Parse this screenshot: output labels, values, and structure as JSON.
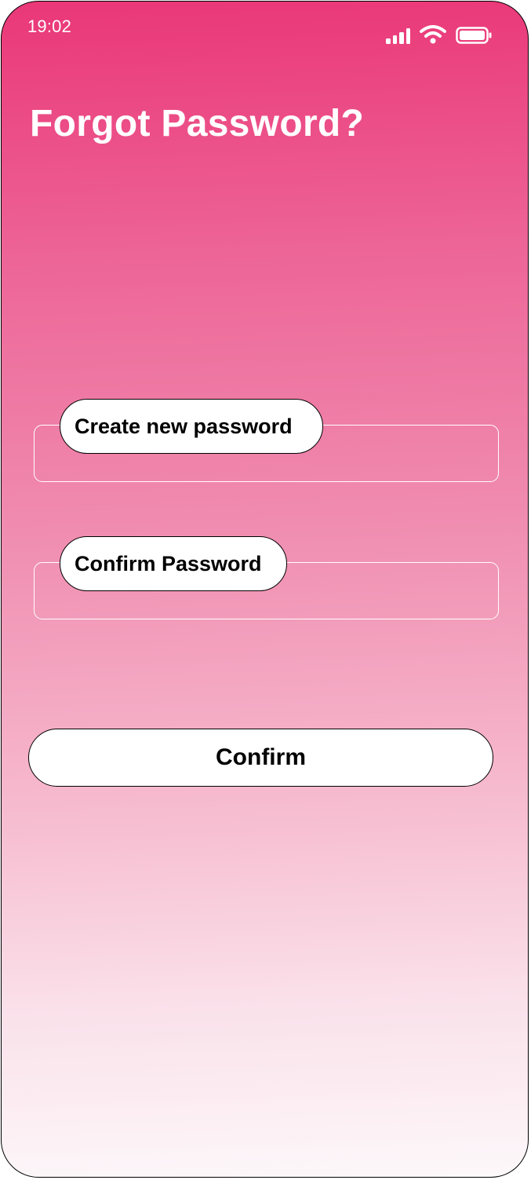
{
  "status_bar": {
    "time": "19:02",
    "icons": [
      "cellular-signal-icon",
      "wifi-icon",
      "battery-icon"
    ]
  },
  "header": {
    "title": "Forgot Password?"
  },
  "form": {
    "new_password": {
      "label": "Create new password",
      "value": ""
    },
    "confirm_password": {
      "label": "Confirm Password",
      "value": ""
    },
    "submit_label": "Confirm"
  },
  "colors": {
    "gradient_top": "#ea3777",
    "gradient_bottom": "#fdf8fa",
    "text_primary": "#000000",
    "text_on_accent": "#ffffff"
  }
}
